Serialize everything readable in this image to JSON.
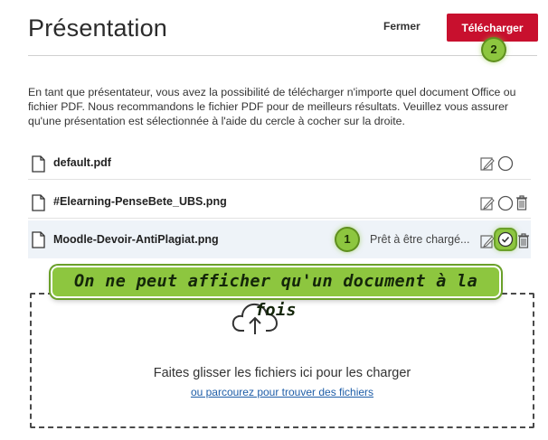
{
  "header": {
    "title": "Présentation",
    "close_label": "Fermer",
    "upload_label": "Télécharger"
  },
  "callouts": {
    "one": "1",
    "two": "2",
    "banner": "On ne peut afficher qu'un document à la fois",
    "color": "#8dc63f"
  },
  "intro": "En tant que présentateur, vous avez la possibilité de télécharger n'importe quel document Office ou fichier PDF. Nous recommandons le fichier PDF pour de meilleurs résultats. Veuillez vous assurer qu'une présentation est sélectionnée à l'aide du cercle à cocher sur la droite.",
  "files": [
    {
      "name": "default.pdf",
      "status": "",
      "selected": false,
      "deletable": false
    },
    {
      "name": "#Elearning-PenseBete_UBS.png",
      "status": "",
      "selected": false,
      "deletable": true
    },
    {
      "name": "Moodle-Devoir-AntiPlagiat.png",
      "status": "Prêt à être chargé...",
      "selected": true,
      "deletable": true
    }
  ],
  "dropzone": {
    "text": "Faites glisser les fichiers ici pour les charger",
    "link": "ou parcourez pour trouver des fichiers"
  },
  "colors": {
    "accent": "#c8102e",
    "link": "#1f5ea8",
    "selected_row": "#eef3f8"
  },
  "icons": [
    "file-icon",
    "edit-icon",
    "radio-icon",
    "check-icon",
    "trash-icon",
    "cloud-upload-icon"
  ]
}
